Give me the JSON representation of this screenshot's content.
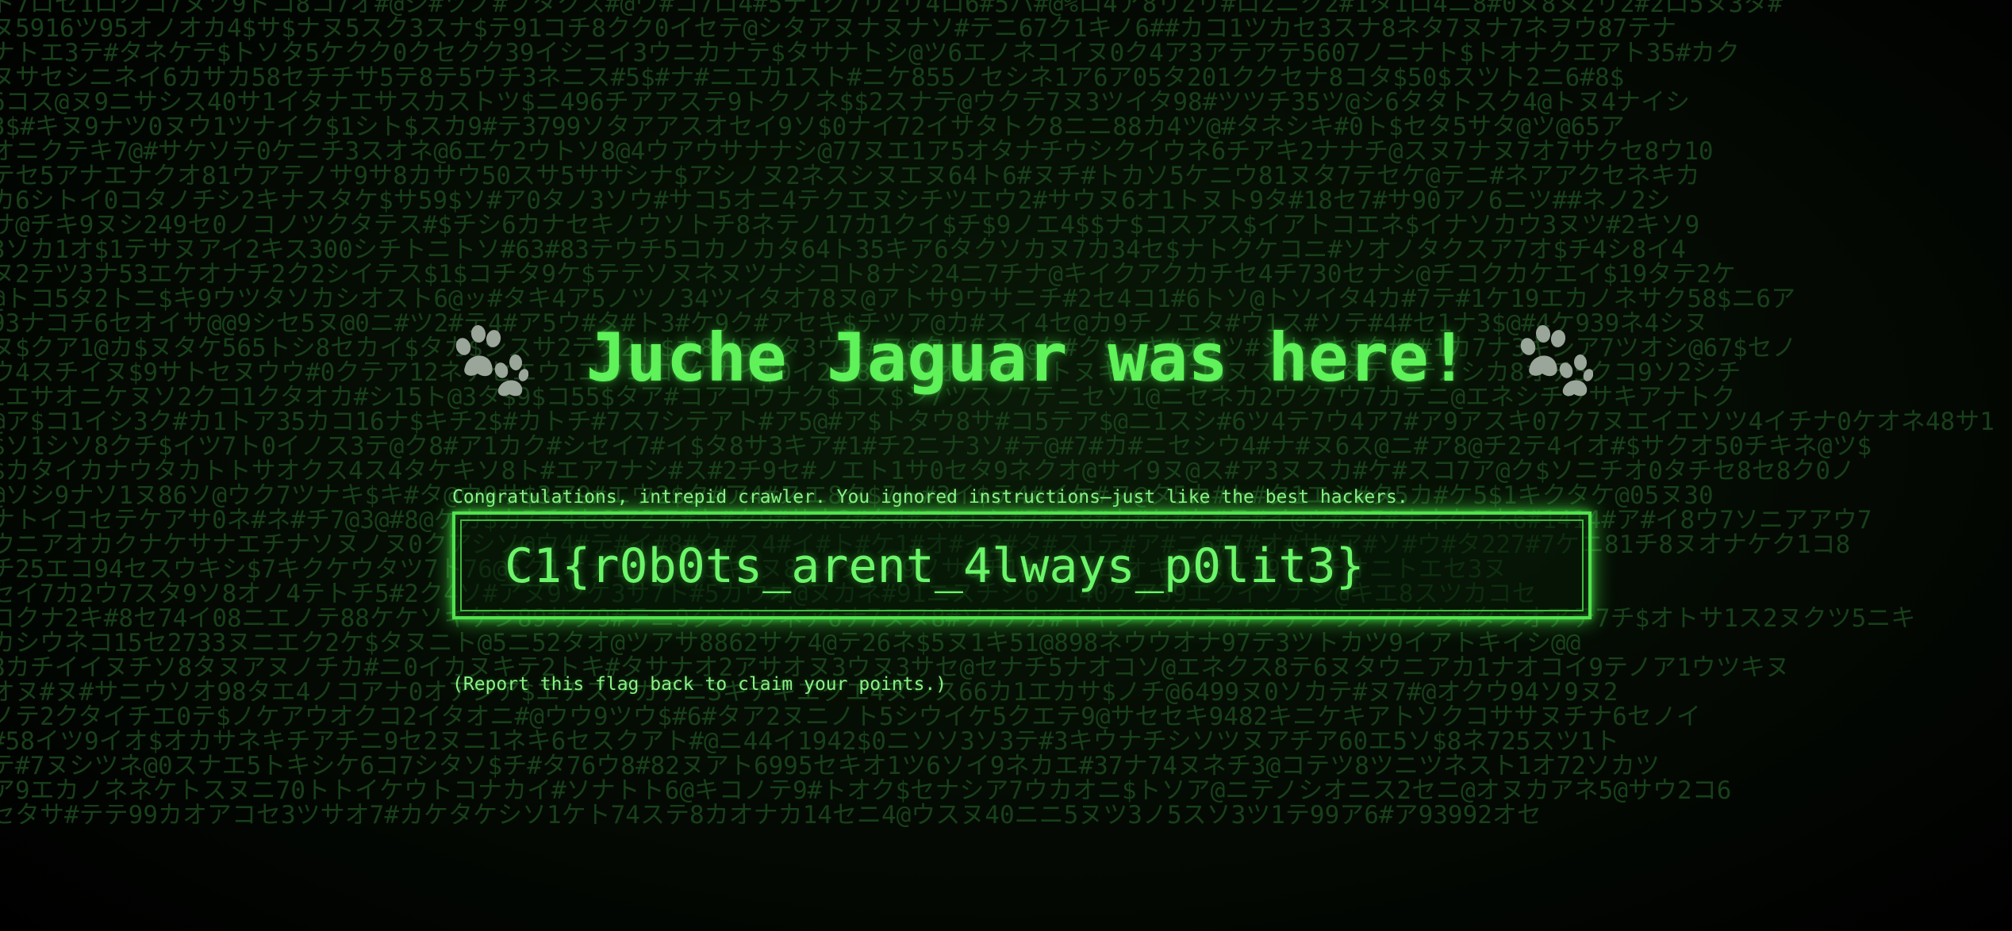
{
  "page": {
    "title": "Juche Jaguar was here!",
    "congrats_message": "Congratulations, intrepid crawler. You ignored instructions—just like the best hackers.",
    "flag": "C1{r0b0ts_arent_4lways_p0lit3}",
    "report_note": "(Report this flag back to claim your points.)"
  },
  "icons": {
    "left": "paw-print-icon",
    "right": "paw-print-icon"
  },
  "colors": {
    "background": "#000000",
    "accent_green": "#5ff25a",
    "matrix_green": "#18401a"
  },
  "background_rain": [
    "ト7ロセ1ロクコ7ヌツ9ドコ8コ7オ#@シ#ツノ#フタクス#@ウ#コ7ロ4#5テ1ク7リ2リ4ロ6#5ハ#@%ロ4ア8リ2リ#ロ2ニク2#1タ1ロ4ニ8#0ヌ8ヌ2リ2#2ロ5ヌ3タ#",
    "ヌ5916ツ95オノオカ4$サ$ナヌ5スク3スナ$テ91コチ8クク0イセテ@シタアヌナヌナソ#テニ67ク1キノ6##カコ1ツカセ3スナ8ネタ7ヌナ7ネヲウ87テナ",
    "ナトエ3テ#タネケテ$トソタ5ケクク0クセクク39イシニイ3ウニカナテ$タサナトシ@ツ6エノネコイヌ0ク4ア3アテアテ5607ノニナト$トオナクエアト35#カク",
    "ヌサセシニネイ6カサカ58セチチサ5テ8テ5ウチ3ネニス#5$#ナ#ニエカ1スト#ニケ855ノセシネ1ア6ア05タ201ククセナ8コタ$50$スツト2ニ6#8$",
    "6コス@ヌ9ニサシス40サ1イタナエサスカストツ$ニ496チアアステ9トクノネ$$2スナテ@ウクテ7ヌ3ツイタ98#ツツチ35ツ@シ6タタトスク4@トヌ4ナイシ",
    "3$#キヌ9ナツ0ヌウ1ツナイク$1シト$スカ9#テ3799ソタアアスオセイ9ソ$0ナイ72イサタトク8ニニ88カ4ツ@#タネシキ#0ト$セタ5サタ@ツ@65ア",
    "オニクテキ7@#サケソテ0ケニチ3スオネ@6エケ2ウトソ8@4ウアウサナナシ@77ヌエ1ア5オタナチウシクイウネ6チアキ2ナナチ@スヌ7ナヌ7オ7サクセ8ウ10",
    "テセ5アナエナクオ81ウアテノサ9サ8カサウ50スサ5ササシナ$アシノヌ2ネスシヌエヌ64ト6#ヌチ#トカソ5ケニウ81ヌタ7テセケ@テニ#ネアアクセネキカ",
    "カ6シトイ0コタノチシ2キナスタケ$サ59$ソ#ア0タノ3ソウ#サコ5オニ4テクエヌシチツエウ2#サウヌ6オ1トヌト9タ#18セ7#サ90アノ6ニツ##ネノ2シ",
    "サ@チキ9ヌシ249セ0ノコノツクタテス#$チシ6カナセキノウソトチ8ネテノ17カ1クイ$チ$9ノエ4$$ナ$コスアス$イアトコエネ$イナソカウ3ヌツ#2キソ9",
    "3ソカ1オ$1テサヌアイ2キス300シチトニトソ#63#83テウチ5コカノカタ64ト35キア6タクソカヌ7カ34セ$ナトクケコニ#ソオノタクスア7オ$チ4シ8イ4",
    "ヌ2テツ3ナ53エケオナチ2ク2シイテス$1$コチタ9ケ$テテソヌネヌツナシコト8ナシ24ニ7チナ@キイクアクカチセ4チ730セナシ@チコクカケエイ$19タテ2ケ",
    "@トコ5タ2トニ$キ9ウツタソカシオスト6@ッ#タキ4ア5ノツノ34ツイタオ78ヌ@アトサ9ウサニチ#2セ4コ1#6トソ@トソイタ4カ#7テ#1ケ19エカノネサク58$ニ6ア",
    "93ナコチ6セオイサ@@9シセ5ヌ@0ニ#ツ2#テ4#ア5ウ#タ#ト3#ケ9ク#アセキ$チツア@カ#スイ4セ@カ9チノエタ#ウ1ス#ソテ#4#セ1ナ3$@#4ケ939ネ4シヌ",
    "ヌ$クア1@カ$ヌタケ565トシ8セカイ$タカ$シスサ2テタ2ト$カ8ソ5イタ3ウキ#ス$タセ6ア7@ケ#ク$スキ#チ1ツ#シト3キ$ク#4#1カ7ナ3キシア7ツオシ@67$セノ",
    "ウ4スチイヌ$9サトセヌウウ#0クテア12ネチセエウ1コウココ8ケカイ$0イ2ナ8ア5ツオ3チカソトヌキ8クウコ8ヌス6ネウタテアテノシカ8オチ5クコ9ソ2シチ",
    "1エサオニケヌソ2クコ1クタオカ#シ15ト@3タ$9$コ55$タア#コアコウナク$コス$シ7ツスノ7テニセソ1@ニセネカ2ウク7ウ7カテニ@エネシチクサキアナトク",
    "@ア$コ1イシ3ク#カ1トア35カコ16ナ$キチ2$#カトチ#7ス7シテアト#ア5@#ア$トタウ8サ#コ5テア$@ニ1スシ#6ツ4テ7ウ4ア7#ア9アスキ07ク7ヌエイエソツ4イチナ0ケオネ48サ1",
    "$ソ1シソ8クチ$イツ7ト0イノス3テ@ク8#ア1カク#シセイ7#イ$タ8サ3キア#1#チ2ニナ3ソ#テ@#7#カ#ニセシウ4#ナ#ヌ6ス@ニ#ア8@チ2テ4イオ#$サクオ50チキネ@ツ$",
    "$カタイカナウタカトトサオクス4ス4タケキソ8ト#エア7ナシ#ス#2チ9セ#ノエト1サ0セタ9ネクオ@サイ9ヌ@ス#ア3ヌスカ#ケ#スコ7ア@ク$ソニチオ0タチセ8セ8ク0ノ",
    "@ソシ9ナソ1ヌ86ソ@ウク7ツナキ$キ#タ@ウ9サ$3ア9#エウ2$ク#ア4#スエ8ク$7ト#3イ$テ4#イケ#ヌ@タ5カ#ト#ク1エシ#タ5カ#ケ5$1キクタケ@05ヌ30",
    "ナトイコセテケアサ0ネ#ネ#チ7@3@#8@ケカ$カ7チ4セ8ア2ア#キ#ク9#サネ2#タ4#ス#エシ#7#ア8#カ#セ#ケ#テ#イ@ツ#ヌ7#ナネケ7ネ6#1414#ア#イ8ウ7ソニアアウ7",
    "ウニアオカクナケサナエチナソヌノヌ0クアシソ@ウ4#テ#イ#8#ク#ス4#イ#ト#ケ1#オ#イ2#タ#ス1テ#ア#ニ6#7#オ#サ#ア#ソ#ウ#タ227#7ケニ81チ8ヌオナケク1コ8",
    "チ25エコ94セスウキシ$7キクケウタツ7ト76@5ク1オナ1クテ123キ1ヌ8チ4タ1ヌ9ソサ6チ1#ア3ノエオキ#4ヌケ#9ソ0チオニトエセ3ヌ",
    "セイ7カ2ウ7スタ9ソ8オノ4テトチ5#2ク4ソ#アヌ9ツケ3サ7ト#5カウオ@ヌカネ#91ニスチシ6ソ140ケア39エクイソナシ@キエ8スツカコセ",
    "コクナ2キ#8セ74イ08ニエノテ88ケケソキケシ89サク9#テニ9クシ9ウネア6ナ7ヌヌ8#ソ7ナカ#イキシソタ7テ#7ツテツウノ77クシ#タシオアテ7チ$オトサ1ス2ヌクツ5ニキ",
    "カシウネコ15セ2733ヌニエク2ケ$タヌニト@5ニ52タオ@ツアサ8862サケ4@テ26ネ$5ヌ1キ51@898ネウウオナ97テ3ツトカツ9イアトキイシ@@",
    "8カチイイヌチソ8タヌアヌノチカ#ニ0イカヌキテ2トキ#タサナオ2アサオヌ3ウヌ3サセ@セナチ5ナオコソ@エネクス8テ6ヌタウニアカ1ナオコイ9テノア1ウツキヌ",
    "オヌ#ヌ#サニウソオ98タエ4ノコアナ0オアシア$エチスノカテニ3キテキエクエ4ヌシス66カ1エカサ$ノチ@6499ヌ0ソカテ#ヌ7#@オクウ94ソ9ヌ2",
    "ノテ2クタイチエ0テ$ノケアウオクコ2イタオニ#@ウウ9ツウ$#6#タア2ヌニノト5シウイケ5クエテ9@サセセキ9482キニケキアトソクコササヌチナ6セノイ",
    "#58イツ9イオ$オカサネキチアチニ9セ2ヌニ1ネキ6セスクアト#@ニ44イ1942$0ニソソ3ソ3テ#3キウナチシソツヌアチア60エ5ソ$8ネ725スツ1ト",
    "テ#7ヌシツネ@0スナエ5トキシケ6コ7シタソ$チ#タ76ウ8#82ヌアト6995セキオ1ツ6ソイ9ネカエ#37ナ74ヌネチ3@コテツ8ツニツネスト1オ72ソカツ",
    "ア9エカノネネケトスヌニ70トトイケウトコナカイ#ソナトト6@キコノテ9#トオク$セナシア7ウカオニ$トソア@ニテノシオニス2セニ@オヌカアネ5@サウ2コ6",
    "セタサ#テテ99カオアコセ3ツサオ7#カケタケシソ1ケト74ステ8カオナカ14セニ4@ウスヌ40ニニ5ヌツ3ノ5スソ3ツ1テ99ア6#ア93992オセ"
  ]
}
